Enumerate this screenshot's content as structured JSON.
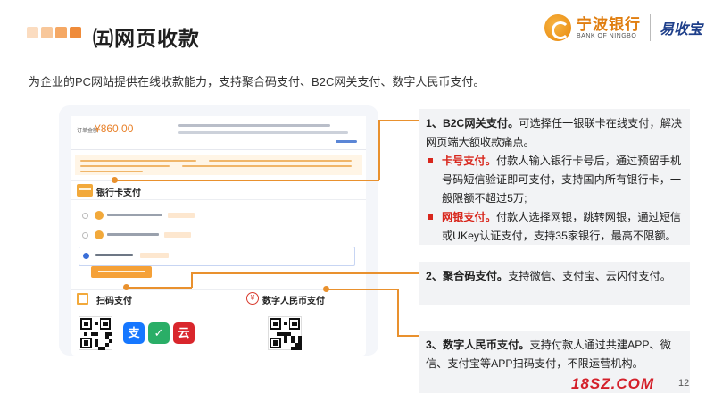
{
  "header": {
    "title": "㈤网页收款",
    "square_colors": [
      "#fbdcc0",
      "#f8c79a",
      "#f5a864",
      "#ef8b3a"
    ],
    "brand_name": "宁波银行",
    "brand_en": "BANK OF NINGBO",
    "product_name": "易收宝"
  },
  "subtitle": "为企业的PC网站提供在线收款能力，支持聚合码支付、B2C网关支付、数字人民币支付。",
  "mock": {
    "amount_label": "订单金额",
    "amount_value": "860.00",
    "card_section_title": "银行卡支付",
    "scan_section_title": "扫码支付",
    "rmb_section_title": "数字人民币支付",
    "apps": [
      {
        "name": "alipay",
        "glyph": "支",
        "color": "#1677ff"
      },
      {
        "name": "wechat",
        "glyph": "✓",
        "color": "#2aae67"
      },
      {
        "name": "unionpay",
        "glyph": "云",
        "color": "#d9262c"
      }
    ]
  },
  "callouts": {
    "b2c": {
      "heading": "1、B2C网关支付。",
      "text": "可选择任一银联卡在线支付，解决网页端大额收款痛点。",
      "items": [
        {
          "label": "卡号支付。",
          "text": "付款人输入银行卡号后，通过预留手机号码短信验证即可支付，支持国内所有银行卡，一般限额不超过5万;"
        },
        {
          "label": "网银支付。",
          "text": "付款人选择网银，跳转网银，通过短信或UKey认证支付，支持35家银行，最高不限额。"
        }
      ]
    },
    "qr": {
      "heading": "2、聚合码支付。",
      "text": "支持微信、支付宝、云闪付支付。"
    },
    "ecny": {
      "heading": "3、数字人民币支付。",
      "text": "支持付款人通过共建APP、微信、支付宝等APP扫码支付，不限运营机构。"
    }
  },
  "footer": {
    "watermark": "18SZ.COM",
    "page_number": "12"
  },
  "colors": {
    "accent": "#e9912e",
    "highlight_red": "#d8261c",
    "callout_bg": "#f2f3f5"
  }
}
